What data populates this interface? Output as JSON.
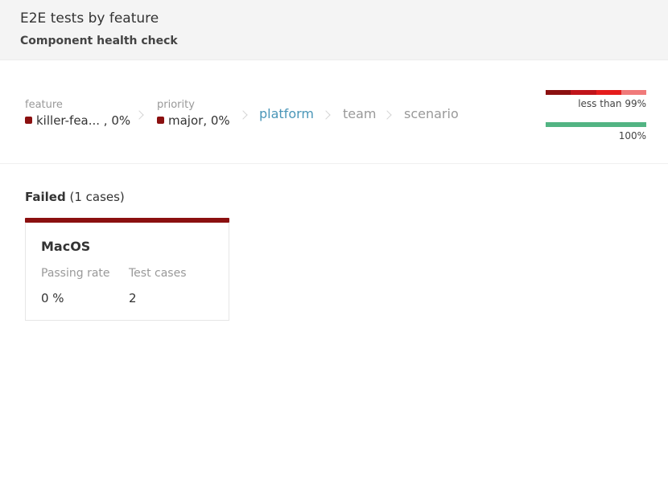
{
  "header": {
    "title": "E2E tests by feature",
    "subtitle": "Component health check"
  },
  "breadcrumbs": {
    "feature": {
      "label": "feature",
      "value": "killer-fea... , 0%"
    },
    "priority": {
      "label": "priority",
      "value": "major, 0%"
    },
    "platform": "platform",
    "team": "team",
    "scenario": "scenario"
  },
  "legend": {
    "failing": {
      "label": "less than 99%",
      "colors": [
        "#8b1010",
        "#c0141a",
        "#e51c1c",
        "#f07a7a"
      ]
    },
    "passing": {
      "label": "100%",
      "color": "#52b483"
    }
  },
  "section": {
    "status": "Failed",
    "count": "(1 cases)"
  },
  "card": {
    "name": "MacOS",
    "passing_rate_label": "Passing rate",
    "passing_rate_value": "0 %",
    "test_cases_label": "Test cases",
    "test_cases_value": "2",
    "accent": "#8b1010"
  }
}
